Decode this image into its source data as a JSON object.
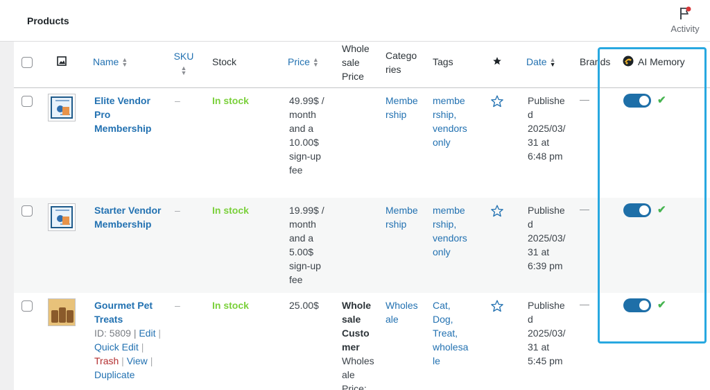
{
  "topbar": {
    "title": "Products",
    "activity_label": "Activity"
  },
  "colors": {
    "accent": "#2271b1",
    "in_stock": "#7ad03a",
    "toggle_on": "#1e6fa8",
    "check": "#46b450",
    "highlight": "#28a8e0"
  },
  "columns": {
    "name": "Name",
    "sku": "SKU",
    "stock": "Stock",
    "price": "Price",
    "wholesale_line1": "Whole",
    "wholesale_line2": "sale",
    "wholesale_line3": "Price",
    "categories_line1": "Catego",
    "categories_line2": "ries",
    "tags": "Tags",
    "date": "Date",
    "brands": "Brands",
    "ai_memory": "AI Memory"
  },
  "products": [
    {
      "name_lines": [
        "Elite Vendor",
        "Pro",
        "Membership"
      ],
      "sku": "–",
      "stock": "In stock",
      "price_lines": [
        "49.99$ /",
        "month",
        "and a",
        "10.00$",
        "sign-up",
        "fee"
      ],
      "wholesale_lines": [],
      "categories_lines": [
        "Membe",
        "rship"
      ],
      "tags_lines": [
        "membe",
        "rship,",
        "vendors",
        "only"
      ],
      "date_lines": [
        "Publishe",
        "d",
        "2025/03/",
        "31 at",
        "6:48 pm"
      ],
      "brands": "—",
      "ai_memory_on": true
    },
    {
      "name_lines": [
        "Starter Vendor",
        "Membership"
      ],
      "sku": "–",
      "stock": "In stock",
      "price_lines": [
        "19.99$ /",
        "month",
        "and a",
        "5.00$",
        "sign-up",
        "fee"
      ],
      "wholesale_lines": [],
      "categories_lines": [
        "Membe",
        "rship"
      ],
      "tags_lines": [
        "membe",
        "rship,",
        "vendors",
        "only"
      ],
      "date_lines": [
        "Publishe",
        "d",
        "2025/03/",
        "31 at",
        "6:39 pm"
      ],
      "brands": "—",
      "ai_memory_on": true
    },
    {
      "name_lines": [
        "Gourmet Pet",
        "Treats"
      ],
      "row_id": "ID: 5809 |",
      "actions": {
        "edit": "Edit",
        "quick_edit": "Quick Edit",
        "trash": "Trash",
        "view": "View",
        "duplicate": "Duplicate",
        "sep": "|"
      },
      "sku": "–",
      "stock": "In stock",
      "price_lines": [
        "25.00$"
      ],
      "wholesale_bold_lines": [
        "Whole",
        "sale",
        "Custo",
        "mer"
      ],
      "wholesale_lines": [
        "Wholes",
        "ale",
        "Price:"
      ],
      "categories_lines": [
        "Wholes",
        "ale"
      ],
      "tags_lines": [
        "Cat,",
        "Dog,",
        "Treat,",
        "wholesa",
        "le"
      ],
      "date_lines": [
        "Publishe",
        "d",
        "2025/03/",
        "31 at",
        "5:45 pm"
      ],
      "brands": "—",
      "ai_memory_on": true
    }
  ]
}
